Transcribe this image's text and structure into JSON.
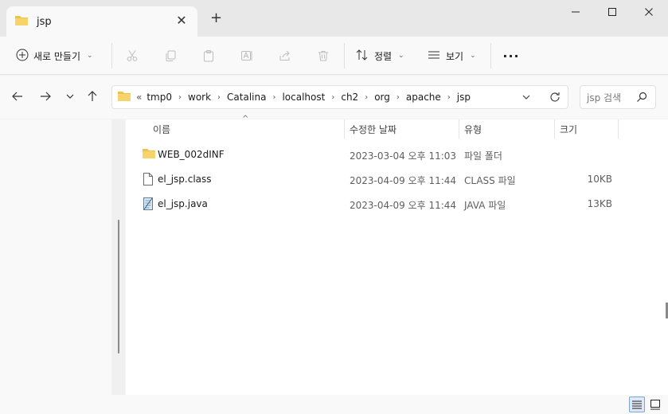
{
  "tab": {
    "title": "jsp",
    "close": "✕",
    "new_tab": "+"
  },
  "toolbar": {
    "new_label": "새로 만들기",
    "sort_label": "정렬",
    "view_label": "보기",
    "more": "···"
  },
  "address": {
    "overflow": "«",
    "crumbs": [
      "tmp0",
      "work",
      "Catalina",
      "localhost",
      "ch2",
      "org",
      "apache",
      "jsp"
    ]
  },
  "search": {
    "placeholder": "jsp 검색"
  },
  "columns": {
    "name": "이름",
    "date": "수정한 날짜",
    "type": "유형",
    "size": "크기"
  },
  "files": [
    {
      "name": "WEB_002dINF",
      "date": "2023-03-04 오후 11:03",
      "type": "파일 폴더",
      "size": "",
      "icon": "folder-icon"
    },
    {
      "name": "el_jsp.class",
      "date": "2023-04-09 오후 11:44",
      "type": "CLASS 파일",
      "size": "10KB",
      "icon": "file-icon"
    },
    {
      "name": "el_jsp.java",
      "date": "2023-04-09 오후 11:44",
      "type": "JAVA 파일",
      "size": "13KB",
      "icon": "java-file-icon"
    }
  ],
  "colors": {
    "folder": "#f0c24b",
    "accent": "#0067c0"
  }
}
